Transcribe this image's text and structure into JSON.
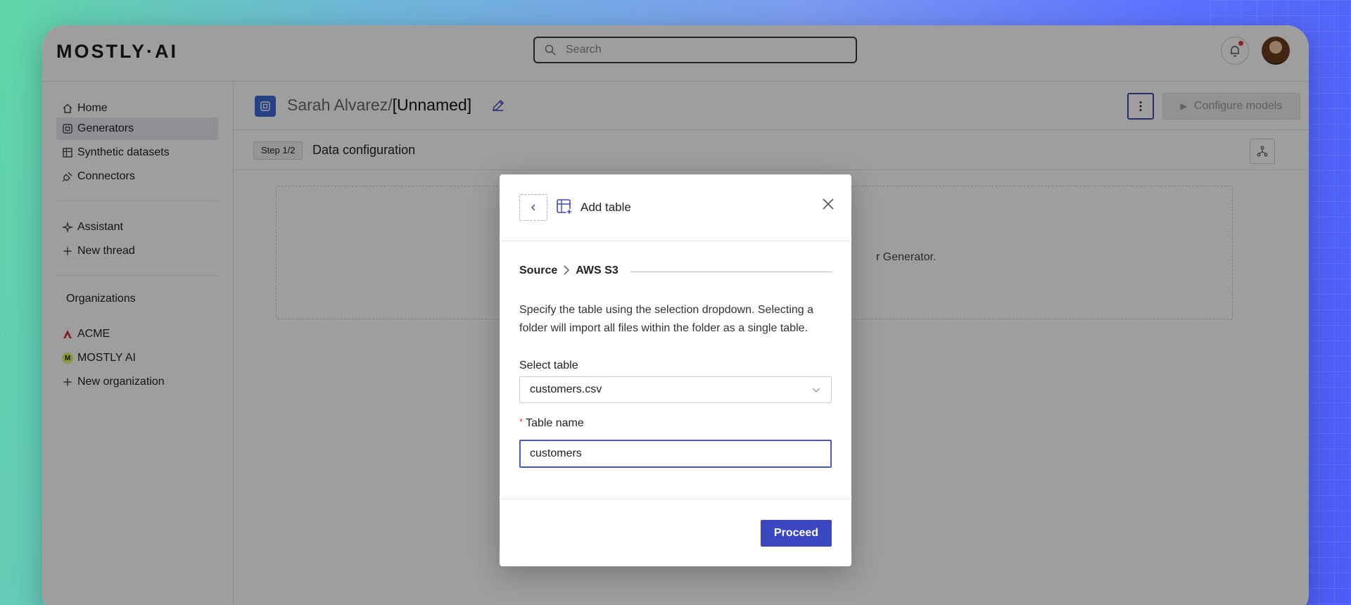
{
  "app": {
    "logo": "MOSTLY·AI",
    "search_placeholder": "Search",
    "notification_badge_color": "#e53935"
  },
  "sidebar": {
    "items": [
      {
        "label": "Home",
        "icon": "home-icon"
      },
      {
        "label": "Generators",
        "icon": "generator-icon",
        "active": true
      },
      {
        "label": "Synthetic datasets",
        "icon": "dataset-icon"
      },
      {
        "label": "Connectors",
        "icon": "plug-icon"
      }
    ],
    "assistant": [
      {
        "label": "Assistant",
        "icon": "sparkle-icon"
      },
      {
        "label": "New thread",
        "icon": "plus-icon"
      }
    ],
    "organizations_heading": "Organizations",
    "organizations": [
      {
        "label": "ACME",
        "icon": "acme-logo-icon"
      },
      {
        "label": "MOSTLY AI",
        "badge": "M",
        "icon": "mostly-ai-badge-icon"
      },
      {
        "label": "New organization",
        "icon": "plus-icon"
      }
    ]
  },
  "header": {
    "owner": "Sarah Alvarez/",
    "generator_name": "[Unnamed]",
    "configure_label": "Configure models"
  },
  "step": {
    "badge": "Step 1/2",
    "title": "Data configuration"
  },
  "dropzone": {
    "text_fragment": "r Generator."
  },
  "modal": {
    "title": "Add table",
    "breadcrumb": {
      "source": "Source",
      "current": "AWS S3"
    },
    "description": "Specify the table using the selection dropdown. Selecting a folder will import all files within the folder as a single table.",
    "select_label": "Select table",
    "select_value": "customers.csv",
    "name_label": "Table name",
    "name_value": "customers",
    "proceed_label": "Proceed"
  },
  "colors": {
    "accent": "#3a47c0",
    "generator_icon": "#3f6bd6",
    "required_marker": "#e53935"
  }
}
